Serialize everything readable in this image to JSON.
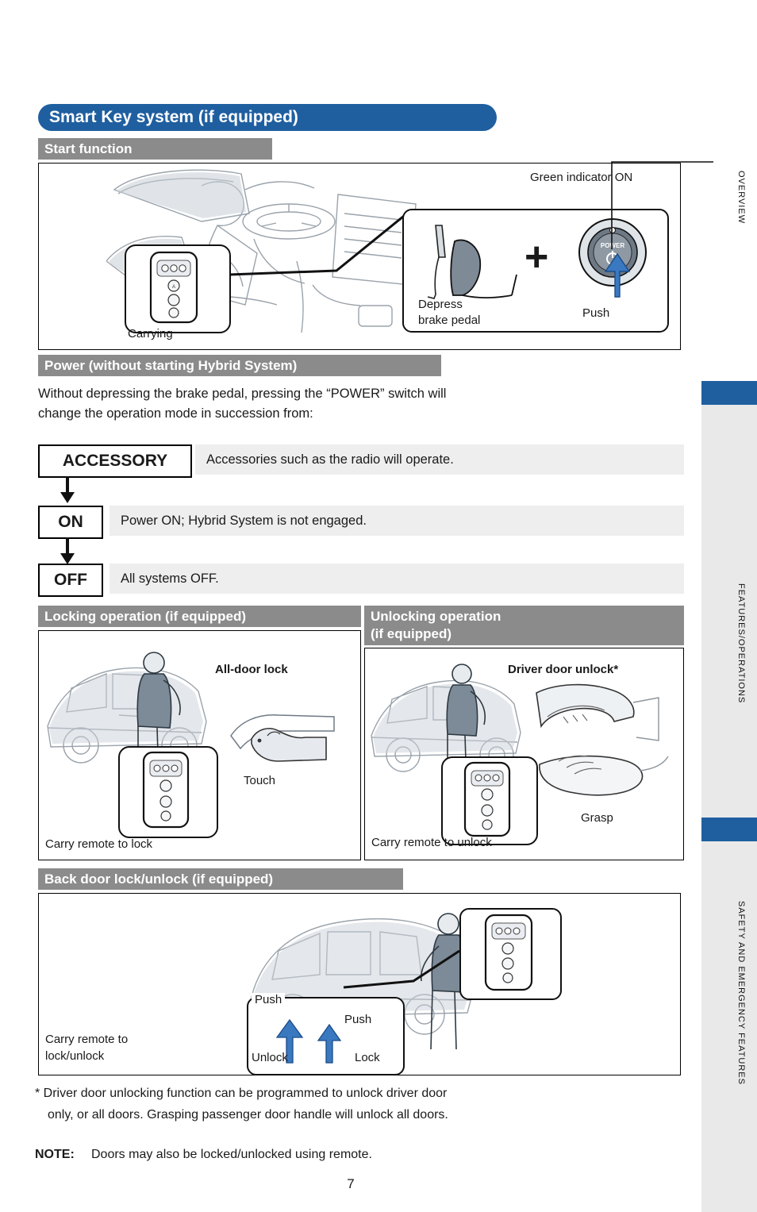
{
  "page": {
    "number": "7",
    "title": "Smart Key system (if equipped)"
  },
  "sections": {
    "start_function": {
      "heading": "Start function",
      "labels": {
        "carrying": "Carrying",
        "green_indicator": "Green indicator ON",
        "depress_brake": "Depress\nbrake pedal",
        "depress_brake_line1": "Depress",
        "depress_brake_line2": "brake pedal",
        "push": "Push",
        "power_switch_text": "POWER",
        "plus": "+"
      }
    },
    "power": {
      "heading": "Power (without starting Hybrid System)",
      "intro_line1": "Without depressing the brake pedal, pressing the “POWER” switch will",
      "intro_line2": "change the operation mode in succession from:",
      "modes": [
        {
          "label": "ACCESSORY",
          "desc": "Accessories such as the radio will operate."
        },
        {
          "label": "ON",
          "desc": "Power ON; Hybrid System is not engaged."
        },
        {
          "label": "OFF",
          "desc": "All systems OFF."
        }
      ]
    },
    "locking": {
      "heading": "Locking operation (if equipped)",
      "all_door_lock": "All-door lock",
      "touch": "Touch",
      "carry_remote": "Carry remote to lock"
    },
    "unlocking": {
      "heading_line1": "Unlocking operation",
      "heading_line2": "(if equipped)",
      "driver_door_unlock": "Driver door unlock*",
      "grasp": "Grasp",
      "carry_remote": "Carry remote to unlock"
    },
    "back_door": {
      "heading": "Back door lock/unlock (if equipped)",
      "carry_remote_line1": "Carry remote to",
      "carry_remote_line2": "lock/unlock",
      "push_top": "Push",
      "push_bottom": "Push",
      "unlock": "Unlock",
      "lock": "Lock"
    },
    "footnotes": {
      "star_line1": "* Driver door unlocking function can be programmed to unlock driver door",
      "star_line2": "only, or all doors. Grasping passenger door handle will unlock all doors.",
      "note_label": "NOTE:",
      "note_text": "Doors may also be locked/unlocked using remote."
    }
  },
  "rail": {
    "tabs": [
      {
        "label": "OVERVIEW",
        "active": false
      },
      {
        "label": "FEATURES/OPERATIONS",
        "active": false
      },
      {
        "label": "SAFETY AND EMERGENCY FEATURES",
        "active": false
      }
    ]
  },
  "colors": {
    "title_blue": "#1f5fa0",
    "sub_gray": "#8b8b8b",
    "desc_gray": "#eeeeee",
    "accent_blue": "#2f6fb5"
  }
}
